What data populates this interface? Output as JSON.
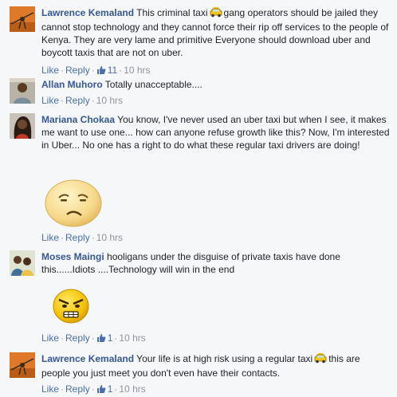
{
  "comments": [
    {
      "author": "Lawrence Kemaland",
      "text_before_icon": "This criminal taxi",
      "text_after_icon": "gang operators should be jailed they cannot stop technology and they cannot force their rip off services to the people of Kenya. They are very lame and primitive Everyone should download uber and boycott taxis that are not on uber.",
      "like_label": "Like",
      "reply_label": "Reply",
      "like_count": "11",
      "time": "10 hrs"
    },
    {
      "author": "Allan Muhoro",
      "text": "Totally unacceptable....",
      "like_label": "Like",
      "reply_label": "Reply",
      "time": "10 hrs"
    },
    {
      "author": "Mariana Chokaa",
      "text": "You know, I've never used an uber taxi but when I see, it makes me want to use one... how can anyone refuse growth like this? Now, I'm interested in Uber... No one has a right to do what these regular taxi drivers are doing!",
      "sticker": "sad-face-sticker",
      "like_label": "Like",
      "reply_label": "Reply",
      "time": "10 hrs"
    },
    {
      "author": "Moses Maingi",
      "text": "hooligans under the disguise of private taxis have done this......Idiots ....Technology will win in the end",
      "sticker": "angry-face-sticker",
      "like_label": "Like",
      "reply_label": "Reply",
      "like_count": "1",
      "time": "10 hrs"
    },
    {
      "author": "Lawrence Kemaland",
      "text_before_icon": "Your life is at high risk using a regular taxi",
      "text_after_icon": "this are people you just meet you don't even have their contacts.",
      "like_label": "Like",
      "reply_label": "Reply",
      "like_count": "1",
      "time": "10 hrs"
    }
  ],
  "colors": {
    "author": "#365899",
    "link": "#4b6eaf",
    "meta": "#90949c",
    "background": "#f6f7f9"
  }
}
